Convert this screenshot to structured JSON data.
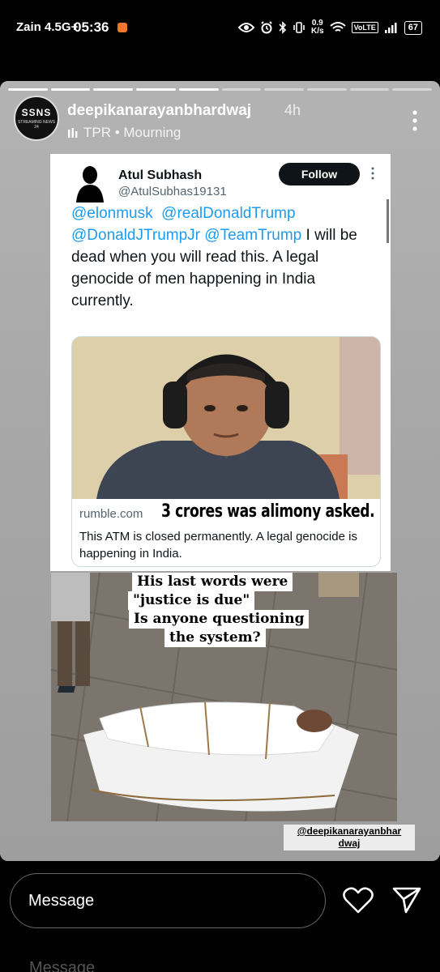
{
  "status_bar": {
    "carrier": "Zain 4.5G+",
    "time": "05:36",
    "net_speed_value": "0.9",
    "net_speed_unit": "K/s",
    "volte": "VoLTE",
    "battery": "67"
  },
  "story": {
    "username": "deepikanarayanbhardwaj",
    "time_ago": "4h",
    "music": "TPR • Mourning",
    "avatar_text": "SSNS",
    "avatar_sub": "STREAMING NEWS 24"
  },
  "tweet": {
    "name": "Atul Subhash",
    "handle": "@AtulSubhas19131",
    "follow_label": "Follow",
    "mentions": [
      "@elonmusk",
      "@realDonaldTrump",
      "@DonaldJTrumpJr",
      "@TeamTrump"
    ],
    "text": "I will be dead when you will read this. A legal genocide of men happening in India currently.",
    "link_card": {
      "domain": "rumble.com",
      "overlay": "3 crores was alimony asked.",
      "description": "This ATM is closed permanently. A legal genocide is happening in India."
    }
  },
  "photo_caption": {
    "line1": "His  last words were",
    "line2": "\"justice is due\"",
    "line3": "Is anyone questioning",
    "line4": "the system?"
  },
  "credit": {
    "line1": "@deepikanarayanbhar",
    "line2": "dwaj"
  },
  "bottom_bar": {
    "message_placeholder": "Message",
    "ghost_text": "Message"
  },
  "icons": {
    "like": "heart-icon",
    "share": "send-icon",
    "options": "more-vertical-icon",
    "music": "music-bars-icon"
  }
}
